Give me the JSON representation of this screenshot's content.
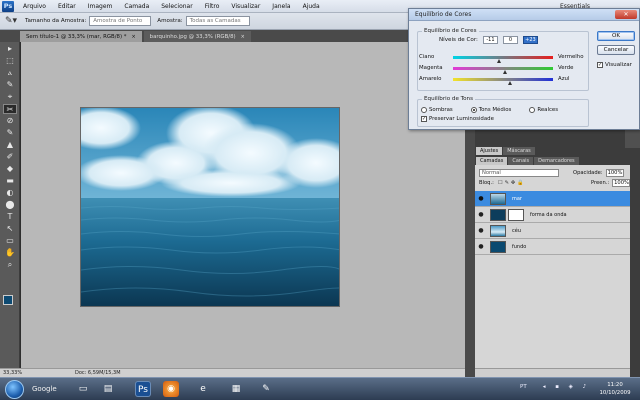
{
  "menubar": {
    "logo": "Ps",
    "items": [
      "Arquivo",
      "Editar",
      "Imagem",
      "Camada",
      "Selecionar",
      "Filtro",
      "Visualizar",
      "Janela",
      "Ajuda"
    ],
    "workspace": "Essentials"
  },
  "options_bar": {
    "tool_icon": "eyedropper-icon",
    "sample_size_label": "Tamanho da Amostra:",
    "sample_size_value": "Amostra de Ponto",
    "sample_label": "Amostra:",
    "sample_value": "Todas as Camadas"
  },
  "tabs": [
    {
      "label": "Sem título-1 @ 33,3% (mar, RGB/8) *",
      "close": "×"
    },
    {
      "label": "barquinho.jpg @ 33,3% (RGB/8)",
      "close": "×"
    }
  ],
  "toolbar": {
    "tools": [
      "▸",
      "⬚",
      "ⲁ",
      "✎",
      "⌖",
      "✂",
      "⊘",
      "✎",
      "▲",
      "✐",
      "◆",
      "▬",
      "◐",
      "⬤",
      "T",
      "↖",
      "▭",
      "✋",
      "⌕"
    ],
    "selected_index": 5,
    "foreground_color": "#0d4a72",
    "background_color": "#ffffff"
  },
  "status": {
    "zoom": "33,33%",
    "doc": "Doc: 6,59M/15,3M"
  },
  "dialog": {
    "title": "Equilíbrio de Cores",
    "color_balance_group": "Equilíbrio de Cores",
    "levels_label": "Níveis de Cor:",
    "levels": [
      "-11",
      "0",
      "+23"
    ],
    "sliders": [
      {
        "left": "Ciano",
        "right": "Vermelho",
        "value": -11
      },
      {
        "left": "Magenta",
        "right": "Verde",
        "value": 0
      },
      {
        "left": "Amarelo",
        "right": "Azul",
        "value": 23
      }
    ],
    "tone_group": "Equilíbrio de Tons",
    "tones": [
      "Sombras",
      "Tons Médios",
      "Realces"
    ],
    "selected_tone": "Tons Médios",
    "preserve_luminosity": "Preservar Luminosidade",
    "ok": "OK",
    "cancel": "Cancelar",
    "preview": "Visualizar"
  },
  "panels": {
    "adjust_tabs": [
      "Ajustes",
      "Máscaras"
    ],
    "layer_tabs": [
      "Camadas",
      "Canais",
      "Demarcadores"
    ],
    "blend_mode": "Normal",
    "opacity_label": "Opacidade:",
    "opacity_value": "100%",
    "lock_label": "Bloq.:",
    "fill_label": "Preen.:",
    "fill_value": "100%",
    "layers": [
      {
        "name": "mar",
        "selected": true
      },
      {
        "name": "forma da onda",
        "selected": false
      },
      {
        "name": "céu",
        "selected": false
      },
      {
        "name": "fundo",
        "selected": false
      }
    ]
  },
  "taskbar": {
    "search_label": "Google",
    "language": "PT",
    "time": "11:20",
    "date": "10/10/2009"
  }
}
